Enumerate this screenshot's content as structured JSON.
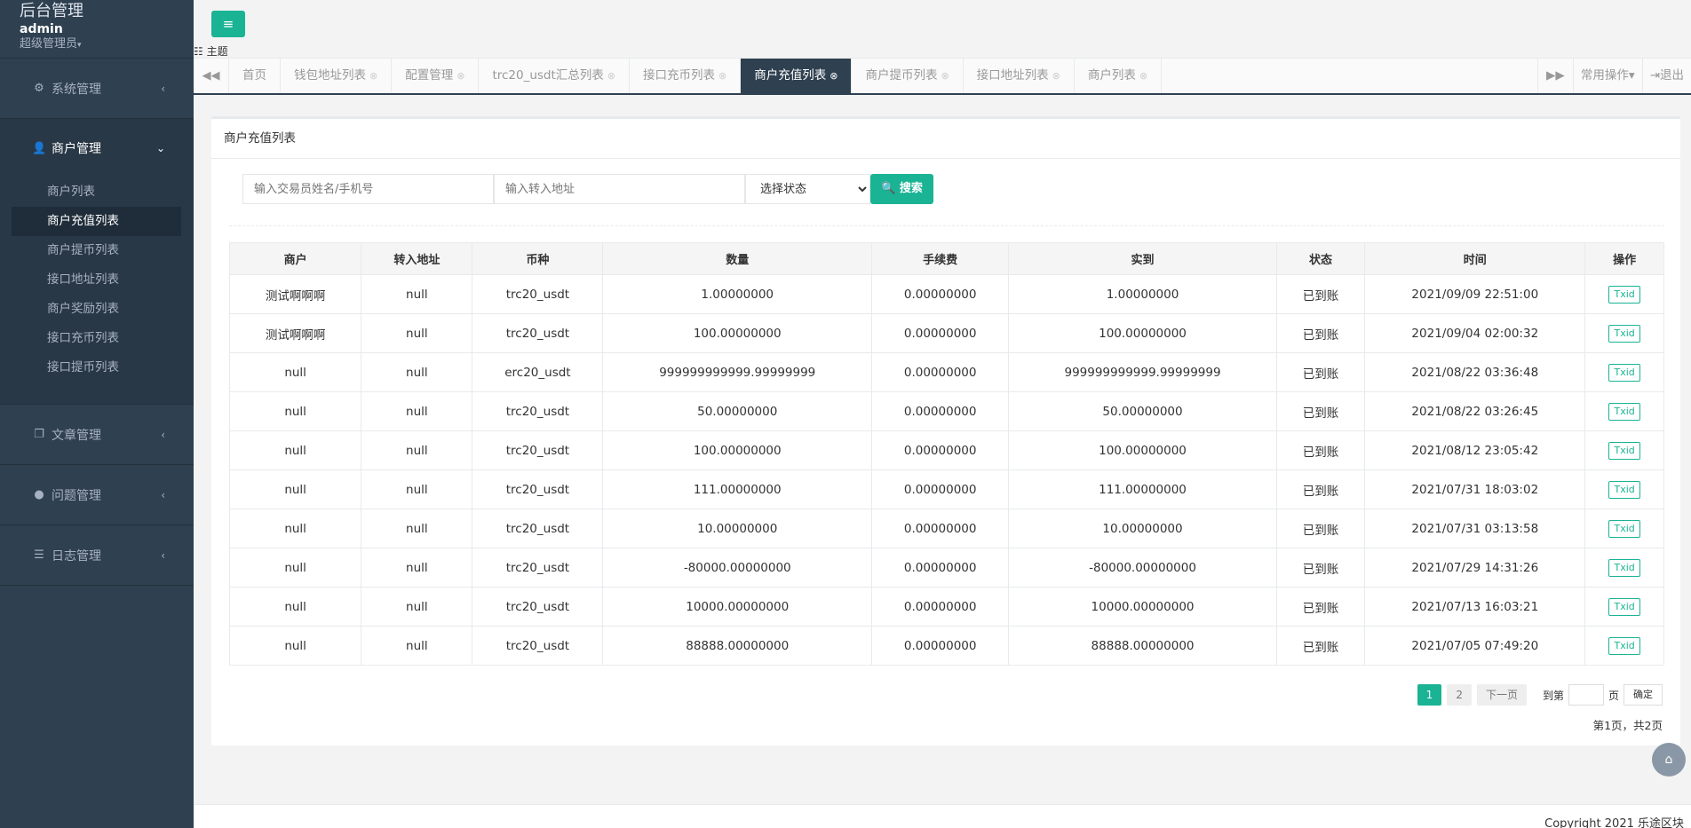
{
  "brand": {
    "title": "后台管理",
    "user": "admin",
    "role": "超级管理员"
  },
  "sidebar": {
    "groups": [
      {
        "label": "系统管理",
        "icon": "gear-icon"
      },
      {
        "label": "商户管理",
        "icon": "user-icon"
      },
      {
        "label": "文章管理",
        "icon": "copy-icon"
      },
      {
        "label": "问题管理",
        "icon": "comment-icon"
      },
      {
        "label": "日志管理",
        "icon": "list-icon"
      }
    ],
    "merchant_items": [
      "商户列表",
      "商户充值列表",
      "商户提币列表",
      "接口地址列表",
      "商户奖励列表",
      "接口充币列表",
      "接口提币列表"
    ]
  },
  "topbar": {
    "theme_label": "主题"
  },
  "tabs": [
    "首页",
    "钱包地址列表",
    "配置管理",
    "trc20_usdt汇总列表",
    "接口充币列表",
    "商户充值列表",
    "商户提币列表",
    "接口地址列表",
    "商户列表"
  ],
  "tools": {
    "common_ops": "常用操作",
    "logout": "退出"
  },
  "panel": {
    "title": "商户充值列表"
  },
  "filters": {
    "name_placeholder": "输入交易员姓名/手机号",
    "address_placeholder": "输入转入地址",
    "status_selected": "选择状态",
    "search_label": "搜索"
  },
  "table": {
    "headers": [
      "商户",
      "转入地址",
      "币种",
      "数量",
      "手续费",
      "实到",
      "状态",
      "时间",
      "操作"
    ],
    "rows": [
      [
        "测试啊啊啊",
        "null",
        "trc20_usdt",
        "1.00000000",
        "0.00000000",
        "1.00000000",
        "已到账",
        "2021/09/09 22:51:00",
        "Txid"
      ],
      [
        "测试啊啊啊",
        "null",
        "trc20_usdt",
        "100.00000000",
        "0.00000000",
        "100.00000000",
        "已到账",
        "2021/09/04 02:00:32",
        "Txid"
      ],
      [
        "null",
        "null",
        "erc20_usdt",
        "999999999999.99999999",
        "0.00000000",
        "999999999999.99999999",
        "已到账",
        "2021/08/22 03:36:48",
        "Txid"
      ],
      [
        "null",
        "null",
        "trc20_usdt",
        "50.00000000",
        "0.00000000",
        "50.00000000",
        "已到账",
        "2021/08/22 03:26:45",
        "Txid"
      ],
      [
        "null",
        "null",
        "trc20_usdt",
        "100.00000000",
        "0.00000000",
        "100.00000000",
        "已到账",
        "2021/08/12 23:05:42",
        "Txid"
      ],
      [
        "null",
        "null",
        "trc20_usdt",
        "111.00000000",
        "0.00000000",
        "111.00000000",
        "已到账",
        "2021/07/31 18:03:02",
        "Txid"
      ],
      [
        "null",
        "null",
        "trc20_usdt",
        "10.00000000",
        "0.00000000",
        "10.00000000",
        "已到账",
        "2021/07/31 03:13:58",
        "Txid"
      ],
      [
        "null",
        "null",
        "trc20_usdt",
        "-80000.00000000",
        "0.00000000",
        "-80000.00000000",
        "已到账",
        "2021/07/29 14:31:26",
        "Txid"
      ],
      [
        "null",
        "null",
        "trc20_usdt",
        "10000.00000000",
        "0.00000000",
        "10000.00000000",
        "已到账",
        "2021/07/13 16:03:21",
        "Txid"
      ],
      [
        "null",
        "null",
        "trc20_usdt",
        "88888.00000000",
        "0.00000000",
        "88888.00000000",
        "已到账",
        "2021/07/05 07:49:20",
        "Txid"
      ]
    ]
  },
  "pager": {
    "pages": [
      "1",
      "2"
    ],
    "next": "下一页",
    "goto_prefix": "到第",
    "goto_suffix": "页",
    "confirm": "确定",
    "info": "第1页，共2页"
  },
  "footer": {
    "copyright": "Copyright 2021 乐途区块"
  },
  "colors": {
    "sidebar": "#2f4050",
    "accent": "#1ab394"
  }
}
